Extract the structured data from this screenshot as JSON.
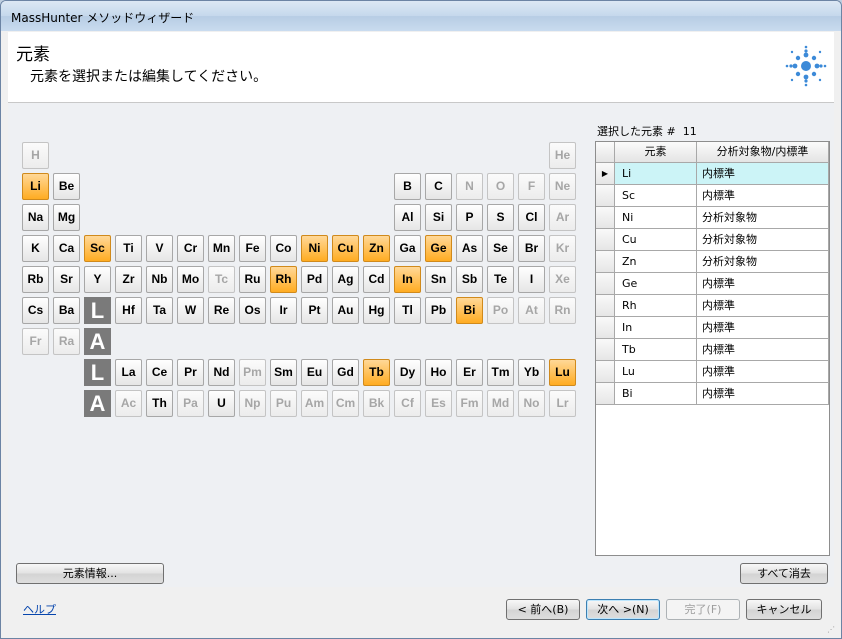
{
  "window": {
    "title": "MassHunter メソッドウィザード"
  },
  "header": {
    "title": "元素",
    "subtitle": "元素を選択または編集してください。"
  },
  "elements": {
    "H": {
      "state": "disabled"
    },
    "He": {
      "state": "disabled"
    },
    "Li": {
      "state": "selected"
    },
    "Be": {
      "state": "normal"
    },
    "B": {
      "state": "normal"
    },
    "C": {
      "state": "normal"
    },
    "N": {
      "state": "disabled"
    },
    "O": {
      "state": "disabled"
    },
    "F": {
      "state": "disabled"
    },
    "Ne": {
      "state": "disabled"
    },
    "Na": {
      "state": "normal"
    },
    "Mg": {
      "state": "normal"
    },
    "Al": {
      "state": "normal"
    },
    "Si": {
      "state": "normal"
    },
    "P": {
      "state": "normal"
    },
    "S": {
      "state": "normal"
    },
    "Cl": {
      "state": "normal"
    },
    "Ar": {
      "state": "disabled"
    },
    "K": {
      "state": "normal"
    },
    "Ca": {
      "state": "normal"
    },
    "Sc": {
      "state": "selected"
    },
    "Ti": {
      "state": "normal"
    },
    "V": {
      "state": "normal"
    },
    "Cr": {
      "state": "normal"
    },
    "Mn": {
      "state": "normal"
    },
    "Fe": {
      "state": "normal"
    },
    "Co": {
      "state": "normal"
    },
    "Ni": {
      "state": "selected"
    },
    "Cu": {
      "state": "selected"
    },
    "Zn": {
      "state": "selected"
    },
    "Ga": {
      "state": "normal"
    },
    "Ge": {
      "state": "selected"
    },
    "As": {
      "state": "normal"
    },
    "Se": {
      "state": "normal"
    },
    "Br": {
      "state": "normal"
    },
    "Kr": {
      "state": "disabled"
    },
    "Rb": {
      "state": "normal"
    },
    "Sr": {
      "state": "normal"
    },
    "Y": {
      "state": "normal"
    },
    "Zr": {
      "state": "normal"
    },
    "Nb": {
      "state": "normal"
    },
    "Mo": {
      "state": "normal"
    },
    "Tc": {
      "state": "disabled"
    },
    "Ru": {
      "state": "normal"
    },
    "Rh": {
      "state": "selected"
    },
    "Pd": {
      "state": "normal"
    },
    "Ag": {
      "state": "normal"
    },
    "Cd": {
      "state": "normal"
    },
    "In": {
      "state": "selected"
    },
    "Sn": {
      "state": "normal"
    },
    "Sb": {
      "state": "normal"
    },
    "Te": {
      "state": "normal"
    },
    "I": {
      "state": "normal"
    },
    "Xe": {
      "state": "disabled"
    },
    "Cs": {
      "state": "normal"
    },
    "Ba": {
      "state": "normal"
    },
    "Hf": {
      "state": "normal"
    },
    "Ta": {
      "state": "normal"
    },
    "W": {
      "state": "normal"
    },
    "Re": {
      "state": "normal"
    },
    "Os": {
      "state": "normal"
    },
    "Ir": {
      "state": "normal"
    },
    "Pt": {
      "state": "normal"
    },
    "Au": {
      "state": "normal"
    },
    "Hg": {
      "state": "normal"
    },
    "Tl": {
      "state": "normal"
    },
    "Pb": {
      "state": "normal"
    },
    "Bi": {
      "state": "selected"
    },
    "Po": {
      "state": "disabled"
    },
    "At": {
      "state": "disabled"
    },
    "Rn": {
      "state": "disabled"
    },
    "Fr": {
      "state": "disabled"
    },
    "Ra": {
      "state": "disabled"
    },
    "La": {
      "state": "normal"
    },
    "Ce": {
      "state": "normal"
    },
    "Pr": {
      "state": "normal"
    },
    "Nd": {
      "state": "normal"
    },
    "Pm": {
      "state": "disabled"
    },
    "Sm": {
      "state": "normal"
    },
    "Eu": {
      "state": "normal"
    },
    "Gd": {
      "state": "normal"
    },
    "Tb": {
      "state": "selected"
    },
    "Dy": {
      "state": "normal"
    },
    "Ho": {
      "state": "normal"
    },
    "Er": {
      "state": "normal"
    },
    "Tm": {
      "state": "normal"
    },
    "Yb": {
      "state": "normal"
    },
    "Lu": {
      "state": "selected"
    },
    "Ac": {
      "state": "disabled"
    },
    "Th": {
      "state": "normal"
    },
    "Pa": {
      "state": "disabled"
    },
    "U": {
      "state": "normal"
    },
    "Np": {
      "state": "disabled"
    },
    "Pu": {
      "state": "disabled"
    },
    "Am": {
      "state": "disabled"
    },
    "Cm": {
      "state": "disabled"
    },
    "Bk": {
      "state": "disabled"
    },
    "Cf": {
      "state": "disabled"
    },
    "Es": {
      "state": "disabled"
    },
    "Fm": {
      "state": "disabled"
    },
    "Md": {
      "state": "disabled"
    },
    "No": {
      "state": "disabled"
    },
    "Lr": {
      "state": "disabled"
    }
  },
  "series_markers": {
    "lanthanide": [
      "L",
      "A"
    ],
    "actinide": [
      "L",
      "A"
    ]
  },
  "selected_panel": {
    "label": "選択した元素 #",
    "count": "11",
    "columns": [
      "元素",
      "分析対象物/内標準"
    ],
    "rows": [
      {
        "element": "Li",
        "type": "内標準"
      },
      {
        "element": "Sc",
        "type": "内標準"
      },
      {
        "element": "Ni",
        "type": "分析対象物"
      },
      {
        "element": "Cu",
        "type": "分析対象物"
      },
      {
        "element": "Zn",
        "type": "分析対象物"
      },
      {
        "element": "Ge",
        "type": "内標準"
      },
      {
        "element": "Rh",
        "type": "内標準"
      },
      {
        "element": "In",
        "type": "内標準"
      },
      {
        "element": "Tb",
        "type": "内標準"
      },
      {
        "element": "Lu",
        "type": "内標準"
      },
      {
        "element": "Bi",
        "type": "内標準"
      }
    ]
  },
  "buttons": {
    "element_info": "元素情報...",
    "clear_all": "すべて消去",
    "back": "< 前へ(B)",
    "next": "次へ >(N)",
    "finish": "完了(F)",
    "cancel": "キャンセル"
  },
  "help_link": "ヘルプ",
  "colors": {
    "selected": "#ffac22",
    "current_row": "#ccf4f7",
    "series_marker": "#7a7a7a"
  },
  "icons": {
    "logo": "agilent-spark-icon",
    "row_pointer": "triangle-right-icon"
  }
}
